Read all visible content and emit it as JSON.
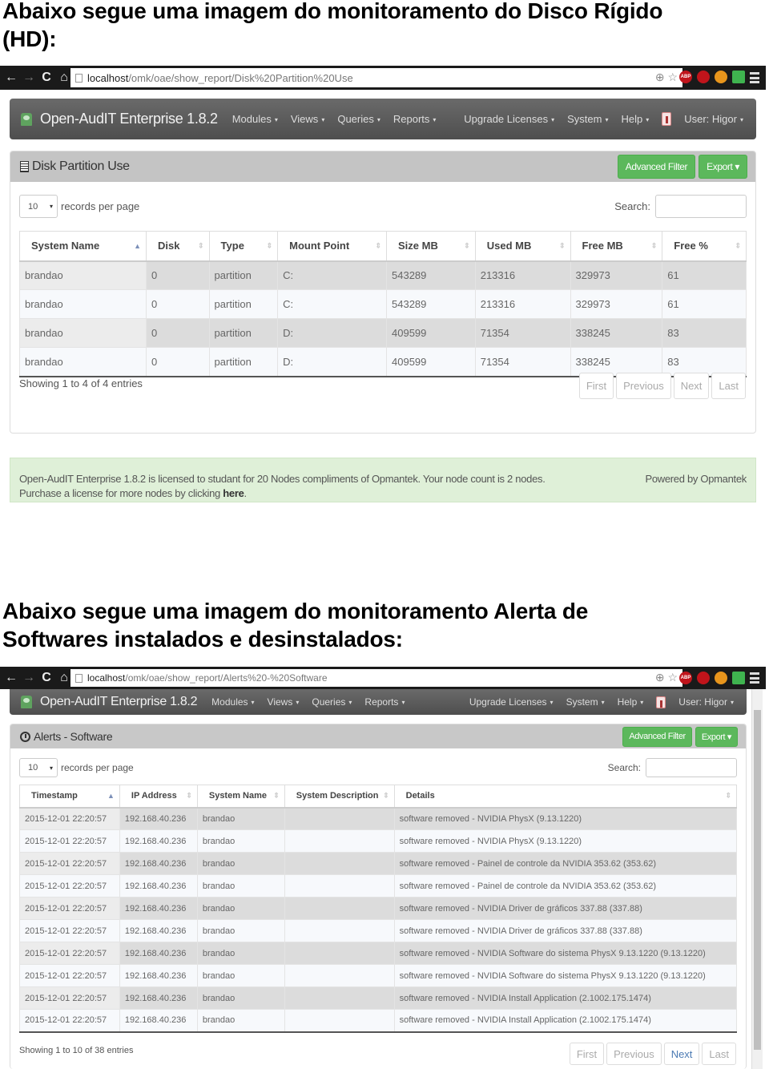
{
  "headings": {
    "disk_line1": "Abaixo segue uma imagem do monitoramento do Disco Rígido",
    "disk_line2": "(HD):",
    "alerts_line1": "Abaixo segue uma imagem do monitoramento Alerta de",
    "alerts_line2": "Softwares instalados e desinstalados:"
  },
  "icons": {
    "back": "←",
    "forward": "→",
    "reload": "C",
    "home": "⌂",
    "zoom": "⊕",
    "star": "☆",
    "caret": "▾",
    "sort_up": "▲",
    "sort_both": "⇕"
  },
  "extensions": [
    {
      "name": "abp",
      "label": "ABP",
      "color": "#c0141b"
    },
    {
      "name": "stop",
      "label": "✋",
      "color": "#c0141b"
    },
    {
      "name": "fire",
      "label": "🔥",
      "color": "#e8951c"
    },
    {
      "name": "rss",
      "label": ")",
      "color": "#3fb34f"
    }
  ],
  "navbar": {
    "brand": "Open-AudIT Enterprise 1.8.2",
    "left_items": [
      "Modules",
      "Views",
      "Queries",
      "Reports"
    ],
    "right_items": [
      "Upgrade Licenses",
      "System",
      "Help"
    ],
    "user": "User: Higor"
  },
  "disk": {
    "url_host": "localhost",
    "url_path": "/omk/oae/show_report/Disk%20Partition%20Use",
    "panel_title": "Disk Partition Use",
    "advanced_filter": "Advanced Filter",
    "export": "Export",
    "records_per_page_value": "10",
    "records_per_page_label": "records per page",
    "search_label": "Search:",
    "columns": [
      "System Name",
      "Disk",
      "Type",
      "Mount Point",
      "Size MB",
      "Used MB",
      "Free MB",
      "Free %"
    ],
    "rows": [
      [
        "brandao",
        "0",
        "partition",
        "C:",
        "543289",
        "213316",
        "329973",
        "61"
      ],
      [
        "brandao",
        "0",
        "partition",
        "C:",
        "543289",
        "213316",
        "329973",
        "61"
      ],
      [
        "brandao",
        "0",
        "partition",
        "D:",
        "409599",
        "71354",
        "338245",
        "83"
      ],
      [
        "brandao",
        "0",
        "partition",
        "D:",
        "409599",
        "71354",
        "338245",
        "83"
      ]
    ],
    "info": "Showing 1 to 4 of 4 entries",
    "pager": [
      "First",
      "Previous",
      "Next",
      "Last"
    ]
  },
  "license": {
    "text1": "Open-AudIT Enterprise 1.8.2 is licensed to studant for 20 Nodes compliments of Opmantek. Your node count is 2 nodes.",
    "text2_prefix": "Purchase a license for more nodes by clicking ",
    "link": "here",
    "text2_suffix": ".",
    "powered": "Powered by Opmantek"
  },
  "alerts": {
    "url_host": "localhost",
    "url_path": "/omk/oae/show_report/Alerts%20-%20Software",
    "panel_title": "Alerts - Software",
    "advanced_filter": "Advanced Filter",
    "export": "Export",
    "records_per_page_value": "10",
    "records_per_page_label": "records per page",
    "search_label": "Search:",
    "columns": [
      "Timestamp",
      "IP Address",
      "System Name",
      "System Description",
      "Details"
    ],
    "rows": [
      [
        "2015-12-01 22:20:57",
        "192.168.40.236",
        "brandao",
        "",
        "software removed - NVIDIA PhysX (9.13.1220)"
      ],
      [
        "2015-12-01 22:20:57",
        "192.168.40.236",
        "brandao",
        "",
        "software removed - NVIDIA PhysX (9.13.1220)"
      ],
      [
        "2015-12-01 22:20:57",
        "192.168.40.236",
        "brandao",
        "",
        "software removed - Painel de controle da NVIDIA 353.62 (353.62)"
      ],
      [
        "2015-12-01 22:20:57",
        "192.168.40.236",
        "brandao",
        "",
        "software removed - Painel de controle da NVIDIA 353.62 (353.62)"
      ],
      [
        "2015-12-01 22:20:57",
        "192.168.40.236",
        "brandao",
        "",
        "software removed - NVIDIA Driver de gráficos 337.88 (337.88)"
      ],
      [
        "2015-12-01 22:20:57",
        "192.168.40.236",
        "brandao",
        "",
        "software removed - NVIDIA Driver de gráficos 337.88 (337.88)"
      ],
      [
        "2015-12-01 22:20:57",
        "192.168.40.236",
        "brandao",
        "",
        "software removed - NVIDIA Software do sistema PhysX 9.13.1220 (9.13.1220)"
      ],
      [
        "2015-12-01 22:20:57",
        "192.168.40.236",
        "brandao",
        "",
        "software removed - NVIDIA Software do sistema PhysX 9.13.1220 (9.13.1220)"
      ],
      [
        "2015-12-01 22:20:57",
        "192.168.40.236",
        "brandao",
        "",
        "software removed - NVIDIA Install Application (2.1002.175.1474)"
      ],
      [
        "2015-12-01 22:20:57",
        "192.168.40.236",
        "brandao",
        "",
        "software removed - NVIDIA Install Application (2.1002.175.1474)"
      ]
    ],
    "info": "Showing 1 to 10 of 38 entries",
    "pager": [
      "First",
      "Previous",
      "Next",
      "Last"
    ],
    "pager_active": [
      "Next"
    ]
  }
}
